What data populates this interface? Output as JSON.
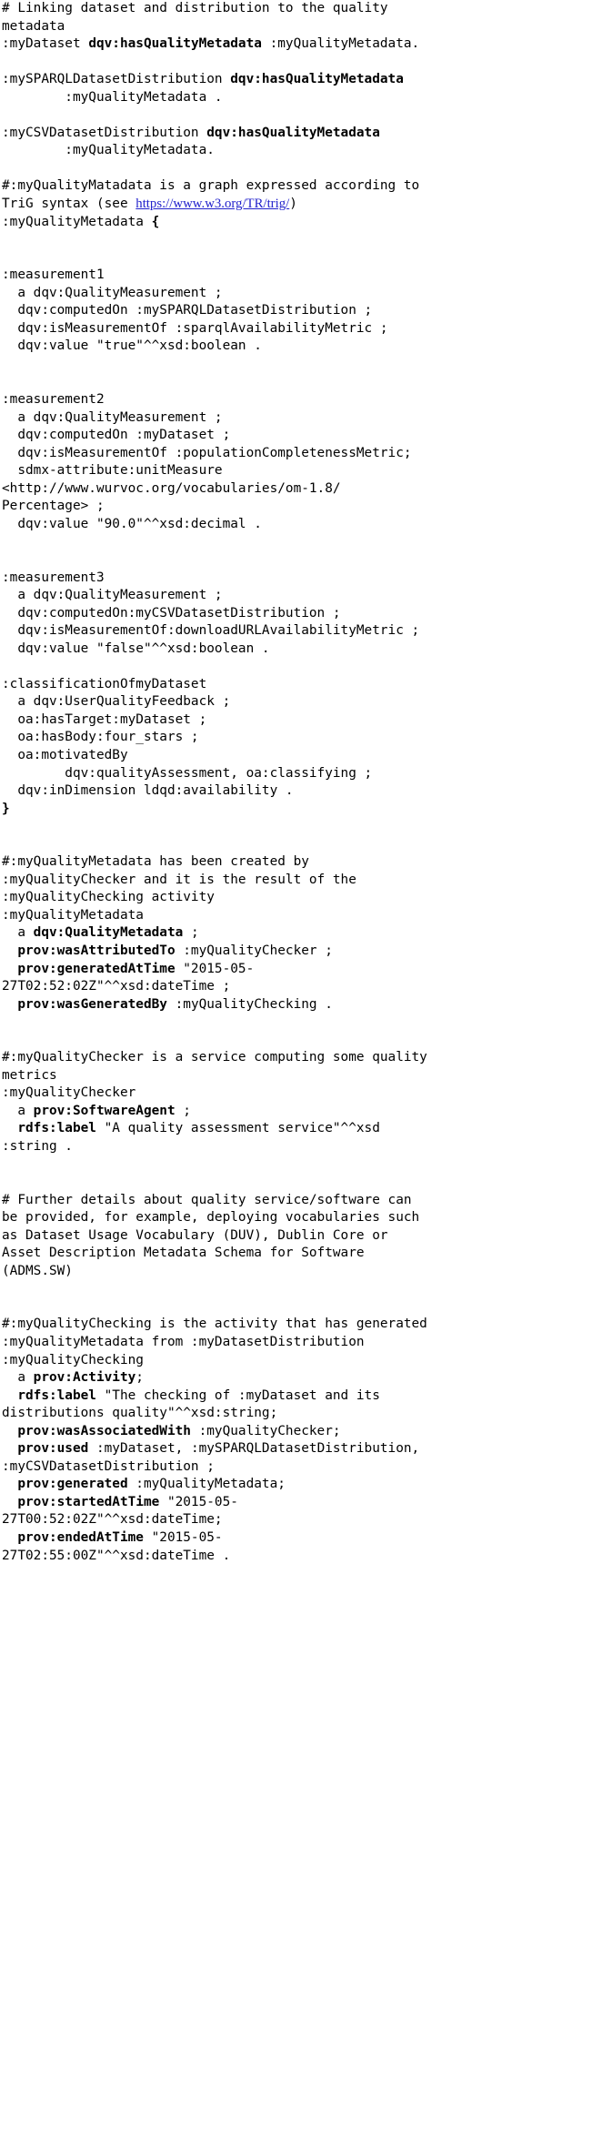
{
  "document": {
    "type": "code-listing",
    "language": "TriG / Turtle RDF",
    "colors": {
      "text": "#000000",
      "background": "#ffffff",
      "link": "#2222cc"
    },
    "link": {
      "text": "https://www.w3.org/TR/trig/",
      "label": "trig-spec-link"
    },
    "lines": [
      {
        "id": "l1",
        "segments": [
          {
            "t": "# Linking dataset and distribution to the quality",
            "b": false
          }
        ]
      },
      {
        "id": "l2",
        "segments": [
          {
            "t": "metadata",
            "b": false
          }
        ]
      },
      {
        "id": "l3",
        "segments": [
          {
            "t": ":myDataset ",
            "b": false
          },
          {
            "t": "dqv:hasQualityMetadata",
            "b": true
          },
          {
            "t": " :myQualityMetadata.",
            "b": false
          }
        ]
      },
      {
        "id": "l4",
        "segments": [
          {
            "t": "",
            "b": false
          }
        ]
      },
      {
        "id": "l5",
        "segments": [
          {
            "t": ":mySPARQLDatasetDistribution ",
            "b": false
          },
          {
            "t": "dqv:hasQualityMetadata",
            "b": true
          }
        ]
      },
      {
        "id": "l6",
        "segments": [
          {
            "t": "        :myQualityMetadata .",
            "b": false
          }
        ]
      },
      {
        "id": "l7",
        "segments": [
          {
            "t": "",
            "b": false
          }
        ]
      },
      {
        "id": "l8",
        "segments": [
          {
            "t": ":myCSVDatasetDistribution ",
            "b": false
          },
          {
            "t": "dqv:hasQualityMetadata",
            "b": true
          }
        ]
      },
      {
        "id": "l9",
        "segments": [
          {
            "t": "        :myQualityMetadata.",
            "b": false
          }
        ]
      },
      {
        "id": "l10",
        "segments": [
          {
            "t": "",
            "b": false
          }
        ]
      },
      {
        "id": "l11",
        "segments": [
          {
            "t": "#:myQualityMatadata is a graph expressed according to",
            "b": false
          }
        ]
      },
      {
        "id": "l12",
        "segments": [
          {
            "t": "TriG syntax (see ",
            "b": false
          },
          {
            "t": "https://www.w3.org/TR/trig/",
            "b": false,
            "link": true
          },
          {
            "t": ")",
            "b": false
          }
        ]
      },
      {
        "id": "l13",
        "segments": [
          {
            "t": ":myQualityMetadata ",
            "b": false
          },
          {
            "t": "{",
            "b": true
          }
        ]
      },
      {
        "id": "l14",
        "segments": [
          {
            "t": "",
            "b": false
          }
        ]
      },
      {
        "id": "l15",
        "segments": [
          {
            "t": "",
            "b": false
          }
        ]
      },
      {
        "id": "l16",
        "segments": [
          {
            "t": ":measurement1",
            "b": false
          }
        ]
      },
      {
        "id": "l17",
        "segments": [
          {
            "t": "  a dqv:QualityMeasurement ;",
            "b": false
          }
        ]
      },
      {
        "id": "l18",
        "segments": [
          {
            "t": "  dqv:computedOn :mySPARQLDatasetDistribution ;",
            "b": false
          }
        ]
      },
      {
        "id": "l19",
        "segments": [
          {
            "t": "  dqv:isMeasurementOf :sparqlAvailabilityMetric ;",
            "b": false
          }
        ]
      },
      {
        "id": "l20",
        "segments": [
          {
            "t": "  dqv:value \"true\"^^xsd:boolean .",
            "b": false
          }
        ]
      },
      {
        "id": "l21",
        "segments": [
          {
            "t": "",
            "b": false
          }
        ]
      },
      {
        "id": "l22",
        "segments": [
          {
            "t": "",
            "b": false
          }
        ]
      },
      {
        "id": "l23",
        "segments": [
          {
            "t": ":measurement2",
            "b": false
          }
        ]
      },
      {
        "id": "l24",
        "segments": [
          {
            "t": "  a dqv:QualityMeasurement ;",
            "b": false
          }
        ]
      },
      {
        "id": "l25",
        "segments": [
          {
            "t": "  dqv:computedOn :myDataset ;",
            "b": false
          }
        ]
      },
      {
        "id": "l26",
        "segments": [
          {
            "t": "  dqv:isMeasurementOf :populationCompletenessMetric;",
            "b": false
          }
        ]
      },
      {
        "id": "l27",
        "segments": [
          {
            "t": "  sdmx-attribute:unitMeasure",
            "b": false
          }
        ]
      },
      {
        "id": "l28",
        "segments": [
          {
            "t": "<http://www.wurvoc.org/vocabularies/om-1.8/",
            "b": false
          }
        ]
      },
      {
        "id": "l29",
        "segments": [
          {
            "t": "Percentage> ;",
            "b": false
          }
        ]
      },
      {
        "id": "l30",
        "segments": [
          {
            "t": "  dqv:value \"90.0\"^^xsd:decimal .",
            "b": false
          }
        ]
      },
      {
        "id": "l31",
        "segments": [
          {
            "t": "",
            "b": false
          }
        ]
      },
      {
        "id": "l32",
        "segments": [
          {
            "t": "",
            "b": false
          }
        ]
      },
      {
        "id": "l33",
        "segments": [
          {
            "t": ":measurement3",
            "b": false
          }
        ]
      },
      {
        "id": "l34",
        "segments": [
          {
            "t": "  a dqv:QualityMeasurement ;",
            "b": false
          }
        ]
      },
      {
        "id": "l35",
        "segments": [
          {
            "t": "  dqv:computedOn:myCSVDatasetDistribution ;",
            "b": false
          }
        ]
      },
      {
        "id": "l36",
        "segments": [
          {
            "t": "  dqv:isMeasurementOf:downloadURLAvailabilityMetric ;",
            "b": false
          }
        ]
      },
      {
        "id": "l37",
        "segments": [
          {
            "t": "  dqv:value \"false\"^^xsd:boolean .",
            "b": false
          }
        ]
      },
      {
        "id": "l38",
        "segments": [
          {
            "t": "",
            "b": false
          }
        ]
      },
      {
        "id": "l39",
        "segments": [
          {
            "t": ":classificationOfmyDataset",
            "b": false
          }
        ]
      },
      {
        "id": "l40",
        "segments": [
          {
            "t": "  a dqv:UserQualityFeedback ;",
            "b": false
          }
        ]
      },
      {
        "id": "l41",
        "segments": [
          {
            "t": "  oa:hasTarget:myDataset ;",
            "b": false
          }
        ]
      },
      {
        "id": "l42",
        "segments": [
          {
            "t": "  oa:hasBody:four_stars ;",
            "b": false
          }
        ]
      },
      {
        "id": "l43",
        "segments": [
          {
            "t": "  oa:motivatedBy",
            "b": false
          }
        ]
      },
      {
        "id": "l44",
        "segments": [
          {
            "t": "        dqv:qualityAssessment, oa:classifying ;",
            "b": false
          }
        ]
      },
      {
        "id": "l45",
        "segments": [
          {
            "t": "  dqv:inDimension ldqd:availability .",
            "b": false
          }
        ]
      },
      {
        "id": "l46",
        "segments": [
          {
            "t": "}",
            "b": true
          }
        ]
      },
      {
        "id": "l47",
        "segments": [
          {
            "t": "",
            "b": false
          }
        ]
      },
      {
        "id": "l48",
        "segments": [
          {
            "t": "",
            "b": false
          }
        ]
      },
      {
        "id": "l49",
        "segments": [
          {
            "t": "#:myQualityMetadata has been created by",
            "b": false
          }
        ]
      },
      {
        "id": "l50",
        "segments": [
          {
            "t": ":myQualityChecker and it is the result of the",
            "b": false
          }
        ]
      },
      {
        "id": "l51",
        "segments": [
          {
            "t": ":myQualityChecking activity",
            "b": false
          }
        ]
      },
      {
        "id": "l52",
        "segments": [
          {
            "t": ":myQualityMetadata",
            "b": false
          }
        ]
      },
      {
        "id": "l53",
        "segments": [
          {
            "t": "  a ",
            "b": false
          },
          {
            "t": "dqv:QualityMetadata",
            "b": true
          },
          {
            "t": " ;",
            "b": false
          }
        ]
      },
      {
        "id": "l54",
        "segments": [
          {
            "t": "  ",
            "b": false
          },
          {
            "t": "prov:wasAttributedTo",
            "b": true
          },
          {
            "t": " :myQualityChecker ;",
            "b": false
          }
        ]
      },
      {
        "id": "l55",
        "segments": [
          {
            "t": "  ",
            "b": false
          },
          {
            "t": "prov:generatedAtTime",
            "b": true
          },
          {
            "t": " \"2015-05-",
            "b": false
          }
        ]
      },
      {
        "id": "l56",
        "segments": [
          {
            "t": "27T02:52:02Z\"^^xsd:dateTime ;",
            "b": false
          }
        ]
      },
      {
        "id": "l57",
        "segments": [
          {
            "t": "  ",
            "b": false
          },
          {
            "t": "prov:wasGeneratedBy",
            "b": true
          },
          {
            "t": " :myQualityChecking .",
            "b": false
          }
        ]
      },
      {
        "id": "l58",
        "segments": [
          {
            "t": "",
            "b": false
          }
        ]
      },
      {
        "id": "l59",
        "segments": [
          {
            "t": "",
            "b": false
          }
        ]
      },
      {
        "id": "l60",
        "segments": [
          {
            "t": "#:myQualityChecker is a service computing some quality",
            "b": false
          }
        ]
      },
      {
        "id": "l61",
        "segments": [
          {
            "t": "metrics",
            "b": false
          }
        ]
      },
      {
        "id": "l62",
        "segments": [
          {
            "t": ":myQualityChecker",
            "b": false
          }
        ]
      },
      {
        "id": "l63",
        "segments": [
          {
            "t": "  a ",
            "b": false
          },
          {
            "t": "prov:SoftwareAgent",
            "b": true
          },
          {
            "t": " ;",
            "b": false
          }
        ]
      },
      {
        "id": "l64",
        "segments": [
          {
            "t": "  ",
            "b": false
          },
          {
            "t": "rdfs:label",
            "b": true
          },
          {
            "t": " \"A quality assessment service\"^^xsd",
            "b": false
          }
        ]
      },
      {
        "id": "l65",
        "segments": [
          {
            "t": ":string .",
            "b": false
          }
        ]
      },
      {
        "id": "l66",
        "segments": [
          {
            "t": "",
            "b": false
          }
        ]
      },
      {
        "id": "l67",
        "segments": [
          {
            "t": "",
            "b": false
          }
        ]
      },
      {
        "id": "l68",
        "segments": [
          {
            "t": "# Further details about quality service/software can",
            "b": false
          }
        ]
      },
      {
        "id": "l69",
        "segments": [
          {
            "t": "be provided, for example, deploying vocabularies such",
            "b": false
          }
        ]
      },
      {
        "id": "l70",
        "segments": [
          {
            "t": "as Dataset Usage Vocabulary (DUV), Dublin Core or",
            "b": false
          }
        ]
      },
      {
        "id": "l71",
        "segments": [
          {
            "t": "Asset Description Metadata Schema for Software",
            "b": false
          }
        ]
      },
      {
        "id": "l72",
        "segments": [
          {
            "t": "(ADMS.SW)",
            "b": false
          }
        ]
      },
      {
        "id": "l73",
        "segments": [
          {
            "t": "",
            "b": false
          }
        ]
      },
      {
        "id": "l74",
        "segments": [
          {
            "t": "",
            "b": false
          }
        ]
      },
      {
        "id": "l75",
        "segments": [
          {
            "t": "#:myQualityChecking is the activity that has generated",
            "b": false
          }
        ]
      },
      {
        "id": "l76",
        "segments": [
          {
            "t": ":myQualityMetadata from :myDatasetDistribution",
            "b": false
          }
        ]
      },
      {
        "id": "l77",
        "segments": [
          {
            "t": ":myQualityChecking",
            "b": false
          }
        ]
      },
      {
        "id": "l78",
        "segments": [
          {
            "t": "  a ",
            "b": false
          },
          {
            "t": "prov:Activity",
            "b": true
          },
          {
            "t": ";",
            "b": false
          }
        ]
      },
      {
        "id": "l79",
        "segments": [
          {
            "t": "  ",
            "b": false
          },
          {
            "t": "rdfs:label",
            "b": true
          },
          {
            "t": " \"The checking of :myDataset and its",
            "b": false
          }
        ]
      },
      {
        "id": "l80",
        "segments": [
          {
            "t": "distributions quality\"^^xsd:string;",
            "b": false
          }
        ]
      },
      {
        "id": "l81",
        "segments": [
          {
            "t": "  ",
            "b": false
          },
          {
            "t": "prov:wasAssociatedWith",
            "b": true
          },
          {
            "t": " :myQualityChecker;",
            "b": false
          }
        ]
      },
      {
        "id": "l82",
        "segments": [
          {
            "t": "  ",
            "b": false
          },
          {
            "t": "prov:used",
            "b": true
          },
          {
            "t": " :myDataset, :mySPARQLDatasetDistribution,",
            "b": false
          }
        ]
      },
      {
        "id": "l83",
        "segments": [
          {
            "t": ":myCSVDatasetDistribution ;",
            "b": false
          }
        ]
      },
      {
        "id": "l84",
        "segments": [
          {
            "t": "  ",
            "b": false
          },
          {
            "t": "prov:generated",
            "b": true
          },
          {
            "t": " :myQualityMetadata;",
            "b": false
          }
        ]
      },
      {
        "id": "l85",
        "segments": [
          {
            "t": "  ",
            "b": false
          },
          {
            "t": "prov:startedAtTime",
            "b": true
          },
          {
            "t": " \"2015-05-",
            "b": false
          }
        ]
      },
      {
        "id": "l86",
        "segments": [
          {
            "t": "27T00:52:02Z\"^^xsd:dateTime;",
            "b": false
          }
        ]
      },
      {
        "id": "l87",
        "segments": [
          {
            "t": "  ",
            "b": false
          },
          {
            "t": "prov:endedAtTime",
            "b": true
          },
          {
            "t": " \"2015-05-",
            "b": false
          }
        ]
      },
      {
        "id": "l88",
        "segments": [
          {
            "t": "27T02:55:00Z\"^^xsd:dateTime .",
            "b": false
          }
        ]
      }
    ]
  }
}
